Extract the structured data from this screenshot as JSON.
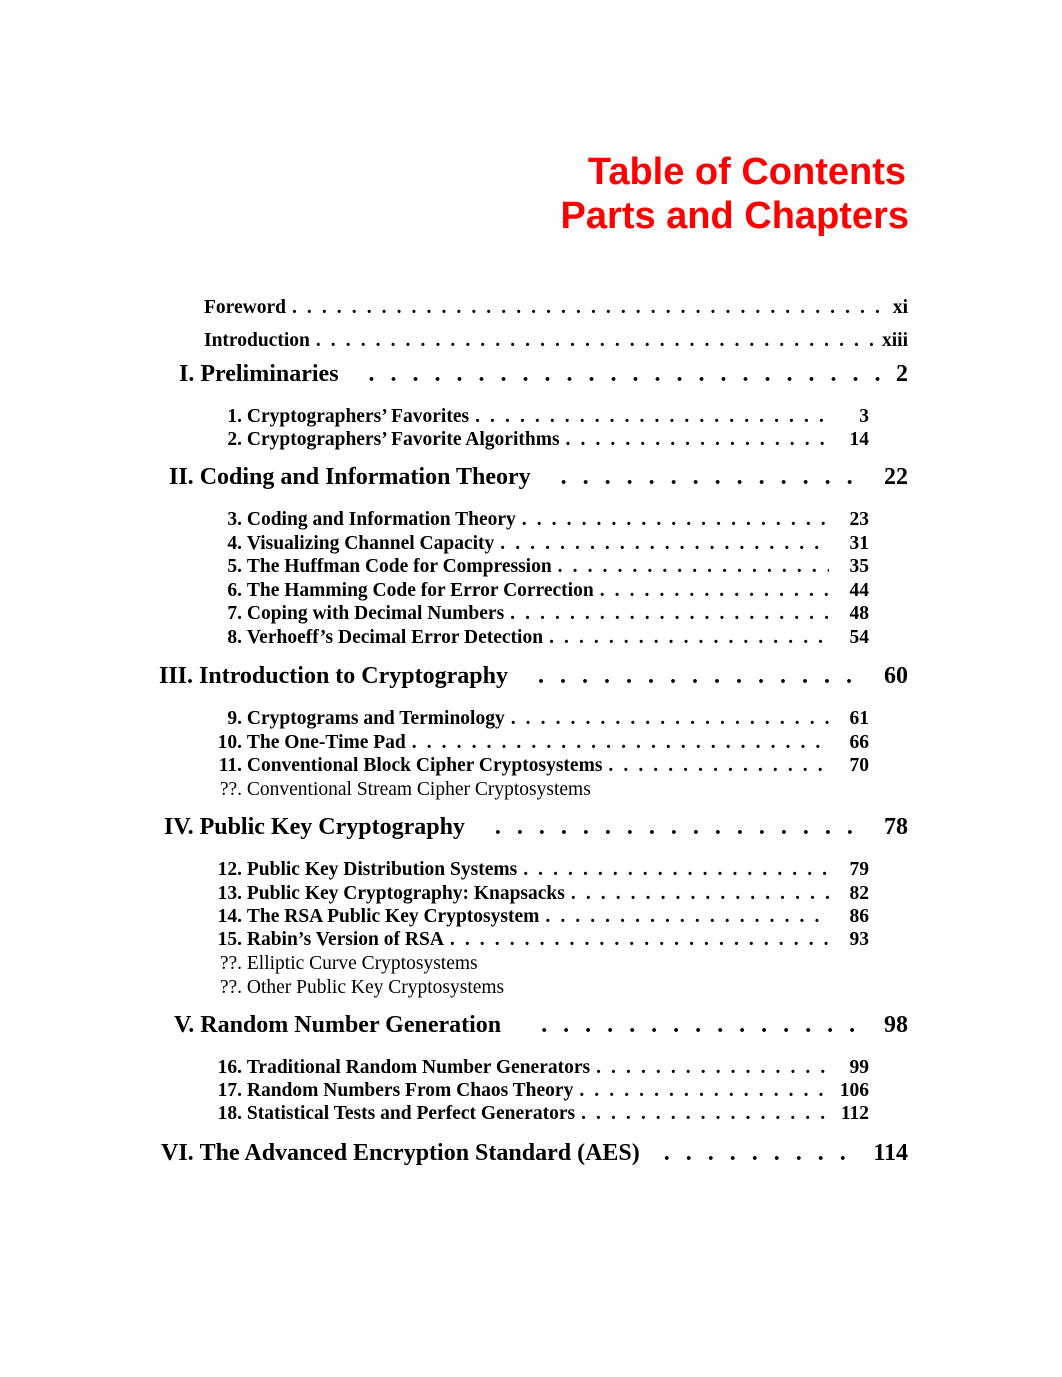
{
  "title": {
    "line1": "Table of Contents",
    "line2": "Parts and Chapters",
    "color": "#ff0000"
  },
  "front_matter": [
    {
      "label": "Foreword",
      "page": "xi"
    },
    {
      "label": "Introduction",
      "page": "xiii"
    }
  ],
  "parts": [
    {
      "num": "I.",
      "title": "Preliminaries",
      "page": "2",
      "chapters": [
        {
          "num": "1.",
          "title": "Cryptographers’ Favorites",
          "page": "3"
        },
        {
          "num": "2.",
          "title": "Cryptographers’ Favorite Algorithms",
          "page": "14"
        }
      ]
    },
    {
      "num": "II.",
      "title": "Coding and Information Theory",
      "page": "22",
      "chapters": [
        {
          "num": "3.",
          "title": "Coding and Information Theory",
          "page": "23"
        },
        {
          "num": "4.",
          "title": "Visualizing Channel Capacity",
          "page": "31"
        },
        {
          "num": "5.",
          "title": "The Huffman Code for Compression",
          "page": "35"
        },
        {
          "num": "6.",
          "title": "The Hamming Code for Error Correction",
          "page": "44"
        },
        {
          "num": "7.",
          "title": "Coping with Decimal Numbers",
          "page": "48"
        },
        {
          "num": "8.",
          "title": "Verhoeff’s Decimal Error Detection",
          "page": "54"
        }
      ]
    },
    {
      "num": "III.",
      "title": "Introduction to Cryptography",
      "page": "60",
      "chapters": [
        {
          "num": "9.",
          "title": "Cryptograms and Terminology",
          "page": "61"
        },
        {
          "num": "10.",
          "title": "The One-Time Pad",
          "page": "66"
        },
        {
          "num": "11.",
          "title": "Conventional Block Cipher Cryptosystems",
          "page": "70"
        },
        {
          "num": "??.",
          "title": "Conventional Stream Cipher Cryptosystems",
          "page": ""
        }
      ]
    },
    {
      "num": "IV.",
      "title": "Public Key Cryptography",
      "page": "78",
      "chapters": [
        {
          "num": "12.",
          "title": "Public Key Distribution Systems",
          "page": "79"
        },
        {
          "num": "13.",
          "title": "Public Key Cryptography: Knapsacks",
          "page": "82"
        },
        {
          "num": "14.",
          "title": "The RSA Public Key Cryptosystem",
          "page": "86"
        },
        {
          "num": "15.",
          "title": "Rabin’s Version of RSA",
          "page": "93"
        },
        {
          "num": "??.",
          "title": "Elliptic Curve Cryptosystems",
          "page": ""
        },
        {
          "num": "??.",
          "title": "Other Public Key Cryptosystems",
          "page": ""
        }
      ]
    },
    {
      "num": "V.",
      "title": "Random Number Generation",
      "page": "98",
      "chapters": [
        {
          "num": "16.",
          "title": "Traditional Random Number Generators",
          "page": "99"
        },
        {
          "num": "17.",
          "title": "Random Numbers From Chaos Theory",
          "page": "106"
        },
        {
          "num": "18.",
          "title": "Statistical Tests and Perfect Generators",
          "page": "112"
        }
      ]
    },
    {
      "num": "VI.",
      "title": "The Advanced Encryption Standard (AES)",
      "page": "114",
      "chapters": []
    }
  ]
}
